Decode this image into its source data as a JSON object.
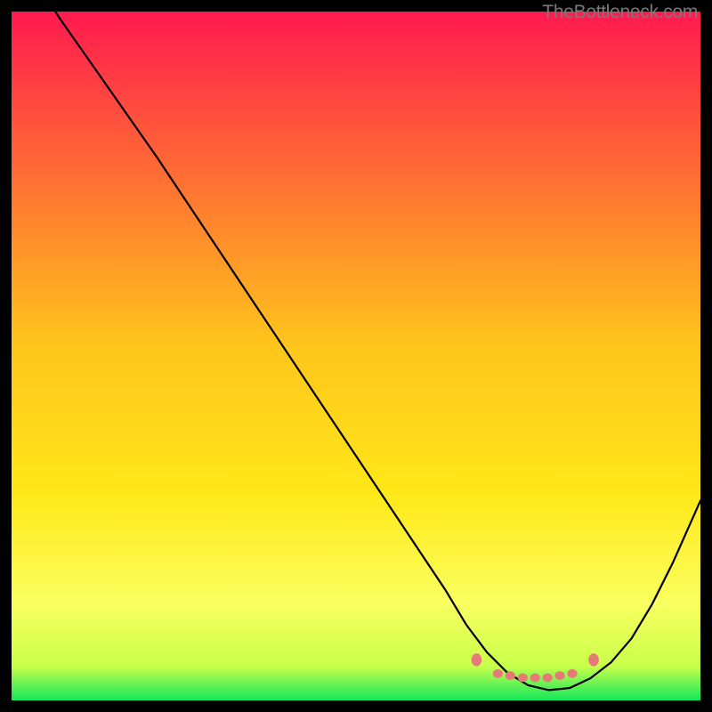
{
  "watermark": "TheBottleneck.com",
  "chart_data": {
    "type": "line",
    "title": "",
    "xlabel": "",
    "ylabel": "",
    "xlim": [
      0,
      100
    ],
    "ylim": [
      0,
      100
    ],
    "grid": false,
    "background_gradient": {
      "top": "#ff1a4f",
      "upper_mid": "#ff8a2a",
      "mid": "#ffe818",
      "lower_mid": "#f9ff60",
      "bottom": "#12e85a"
    },
    "curve_color": "#000000",
    "series": [
      {
        "name": "bottleneck-curve",
        "x": [
          0,
          7,
          14,
          21,
          28,
          35,
          42,
          49,
          56,
          63,
          66,
          69,
          72,
          75,
          78,
          81,
          84,
          87,
          90,
          93,
          96,
          100
        ],
        "y": [
          110,
          99,
          89,
          79,
          68.5,
          58,
          47.5,
          37,
          26.5,
          16,
          11,
          7,
          4,
          2.2,
          1.5,
          1.8,
          3.2,
          5.5,
          9,
          14,
          20,
          29
        ]
      }
    ],
    "markers": {
      "color": "#e77a78",
      "points": [
        {
          "x": 67.5,
          "y": 5.9
        },
        {
          "x": 70.6,
          "y": 3.9
        },
        {
          "x": 72.4,
          "y": 3.6
        },
        {
          "x": 74.2,
          "y": 3.3
        },
        {
          "x": 76.0,
          "y": 3.3
        },
        {
          "x": 77.8,
          "y": 3.3
        },
        {
          "x": 79.6,
          "y": 3.6
        },
        {
          "x": 81.4,
          "y": 3.9
        },
        {
          "x": 84.5,
          "y": 5.9
        }
      ],
      "end_radius": 5.8,
      "mid_radius": 4.9
    }
  }
}
